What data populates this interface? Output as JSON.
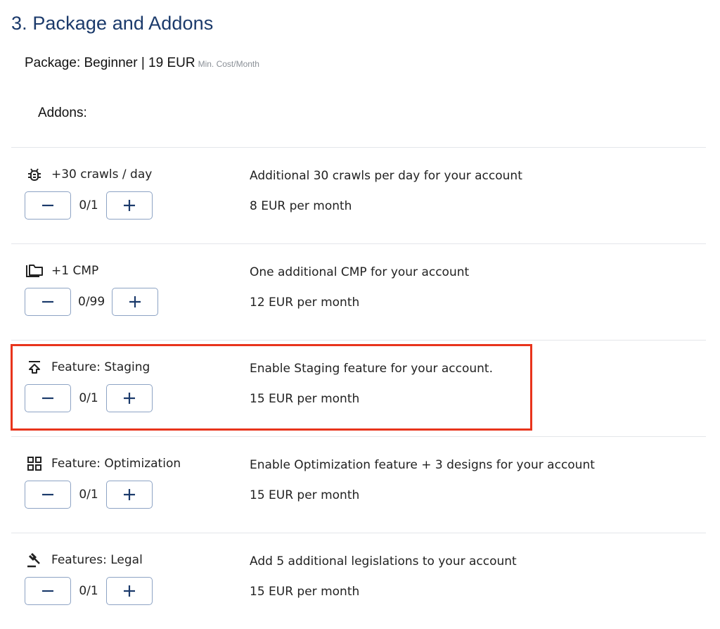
{
  "section": {
    "title": "3. Package and Addons"
  },
  "package": {
    "text": "Package: Beginner | 19 EUR",
    "note": "Min. Cost/Month"
  },
  "addons_label": "Addons:",
  "addons": [
    {
      "icon": "bug-icon",
      "title": "+30 crawls / day",
      "count": "0/1",
      "description": "Additional 30 crawls per day for your account",
      "price": "8 EUR per month"
    },
    {
      "icon": "folder-icon",
      "title": "+1 CMP",
      "count": "0/99",
      "description": "One additional CMP for your account",
      "price": "12 EUR per month"
    },
    {
      "icon": "upload-icon",
      "title": "Feature: Staging",
      "count": "0/1",
      "description": "Enable Staging feature for your account.",
      "price": "15 EUR per month"
    },
    {
      "icon": "grid-icon",
      "title": "Feature: Optimization",
      "count": "0/1",
      "description": "Enable Optimization feature + 3 designs for your account",
      "price": "15 EUR per month"
    },
    {
      "icon": "gavel-icon",
      "title": "Features: Legal",
      "count": "0/1",
      "description": "Add 5 additional legislations to your account",
      "price": "15 EUR per month"
    }
  ],
  "colors": {
    "title": "#1b3a6b",
    "button_border": "#8da3c4",
    "highlight": "#e8341c"
  }
}
